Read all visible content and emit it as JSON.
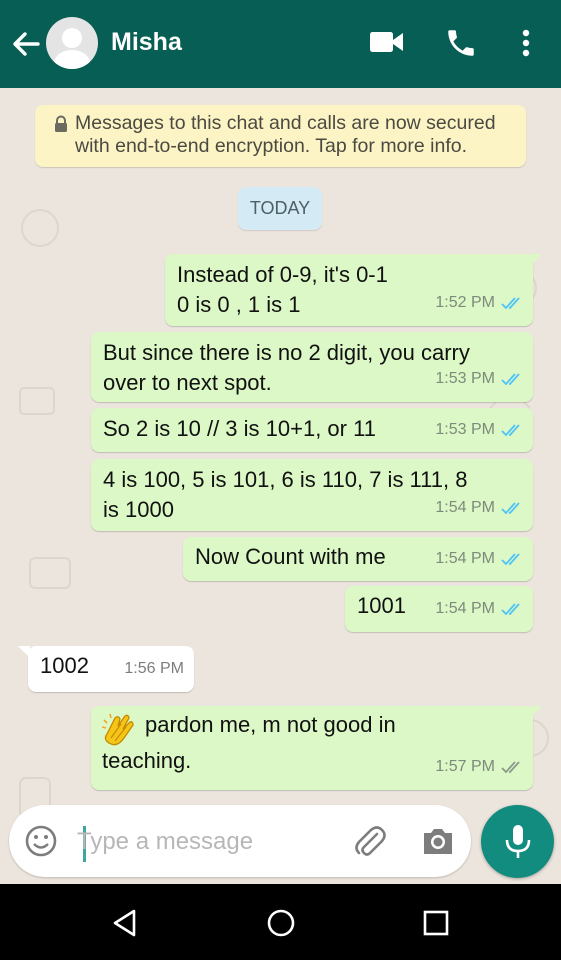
{
  "header": {
    "contact_name": "Misha",
    "icons": [
      "back-arrow-icon",
      "avatar",
      "video-call-icon",
      "phone-call-icon",
      "more-options-icon"
    ]
  },
  "encryption_notice": {
    "line1": "Messages to this chat and calls are now secured",
    "line2": "with end-to-end encryption. Tap for more info."
  },
  "date_divider": "TODAY",
  "messages": [
    {
      "direction": "out",
      "lines": [
        "Instead of 0-9, it's 0-1",
        "0 is 0 , 1 is 1"
      ],
      "time": "1:52 PM",
      "status": "read"
    },
    {
      "direction": "out",
      "lines": [
        "But since there is no 2 digit, you carry",
        "over to next spot."
      ],
      "time": "1:53 PM",
      "status": "read"
    },
    {
      "direction": "out",
      "lines": [
        "So 2 is 10 // 3 is 10+1, or 11"
      ],
      "time": "1:53 PM",
      "status": "read"
    },
    {
      "direction": "out",
      "lines": [
        "4 is 100, 5 is 101, 6 is 110, 7 is 111, 8",
        "is 1000"
      ],
      "time": "1:54 PM",
      "status": "read"
    },
    {
      "direction": "out",
      "lines": [
        "Now Count with me"
      ],
      "time": "1:54 PM",
      "status": "read"
    },
    {
      "direction": "out",
      "lines": [
        "1001"
      ],
      "time": "1:54 PM",
      "status": "read"
    },
    {
      "direction": "in",
      "lines": [
        "1002"
      ],
      "time": "1:56 PM"
    },
    {
      "direction": "out",
      "lines": [
        "pardon me, m not good in",
        "teaching."
      ],
      "time": "1:57 PM",
      "status": "delivered",
      "emoji": "clapping-hands-icon"
    }
  ],
  "composer": {
    "placeholder": "Type a message",
    "value": ""
  },
  "colors": {
    "header": "#075e54",
    "outgoing_bubble": "#dcf8c6",
    "incoming_bubble": "#ffffff",
    "read_ticks": "#4fc3f7",
    "mic_button": "#128c7e"
  },
  "system_nav": [
    "back-triangle-icon",
    "home-circle-icon",
    "recents-square-icon"
  ]
}
